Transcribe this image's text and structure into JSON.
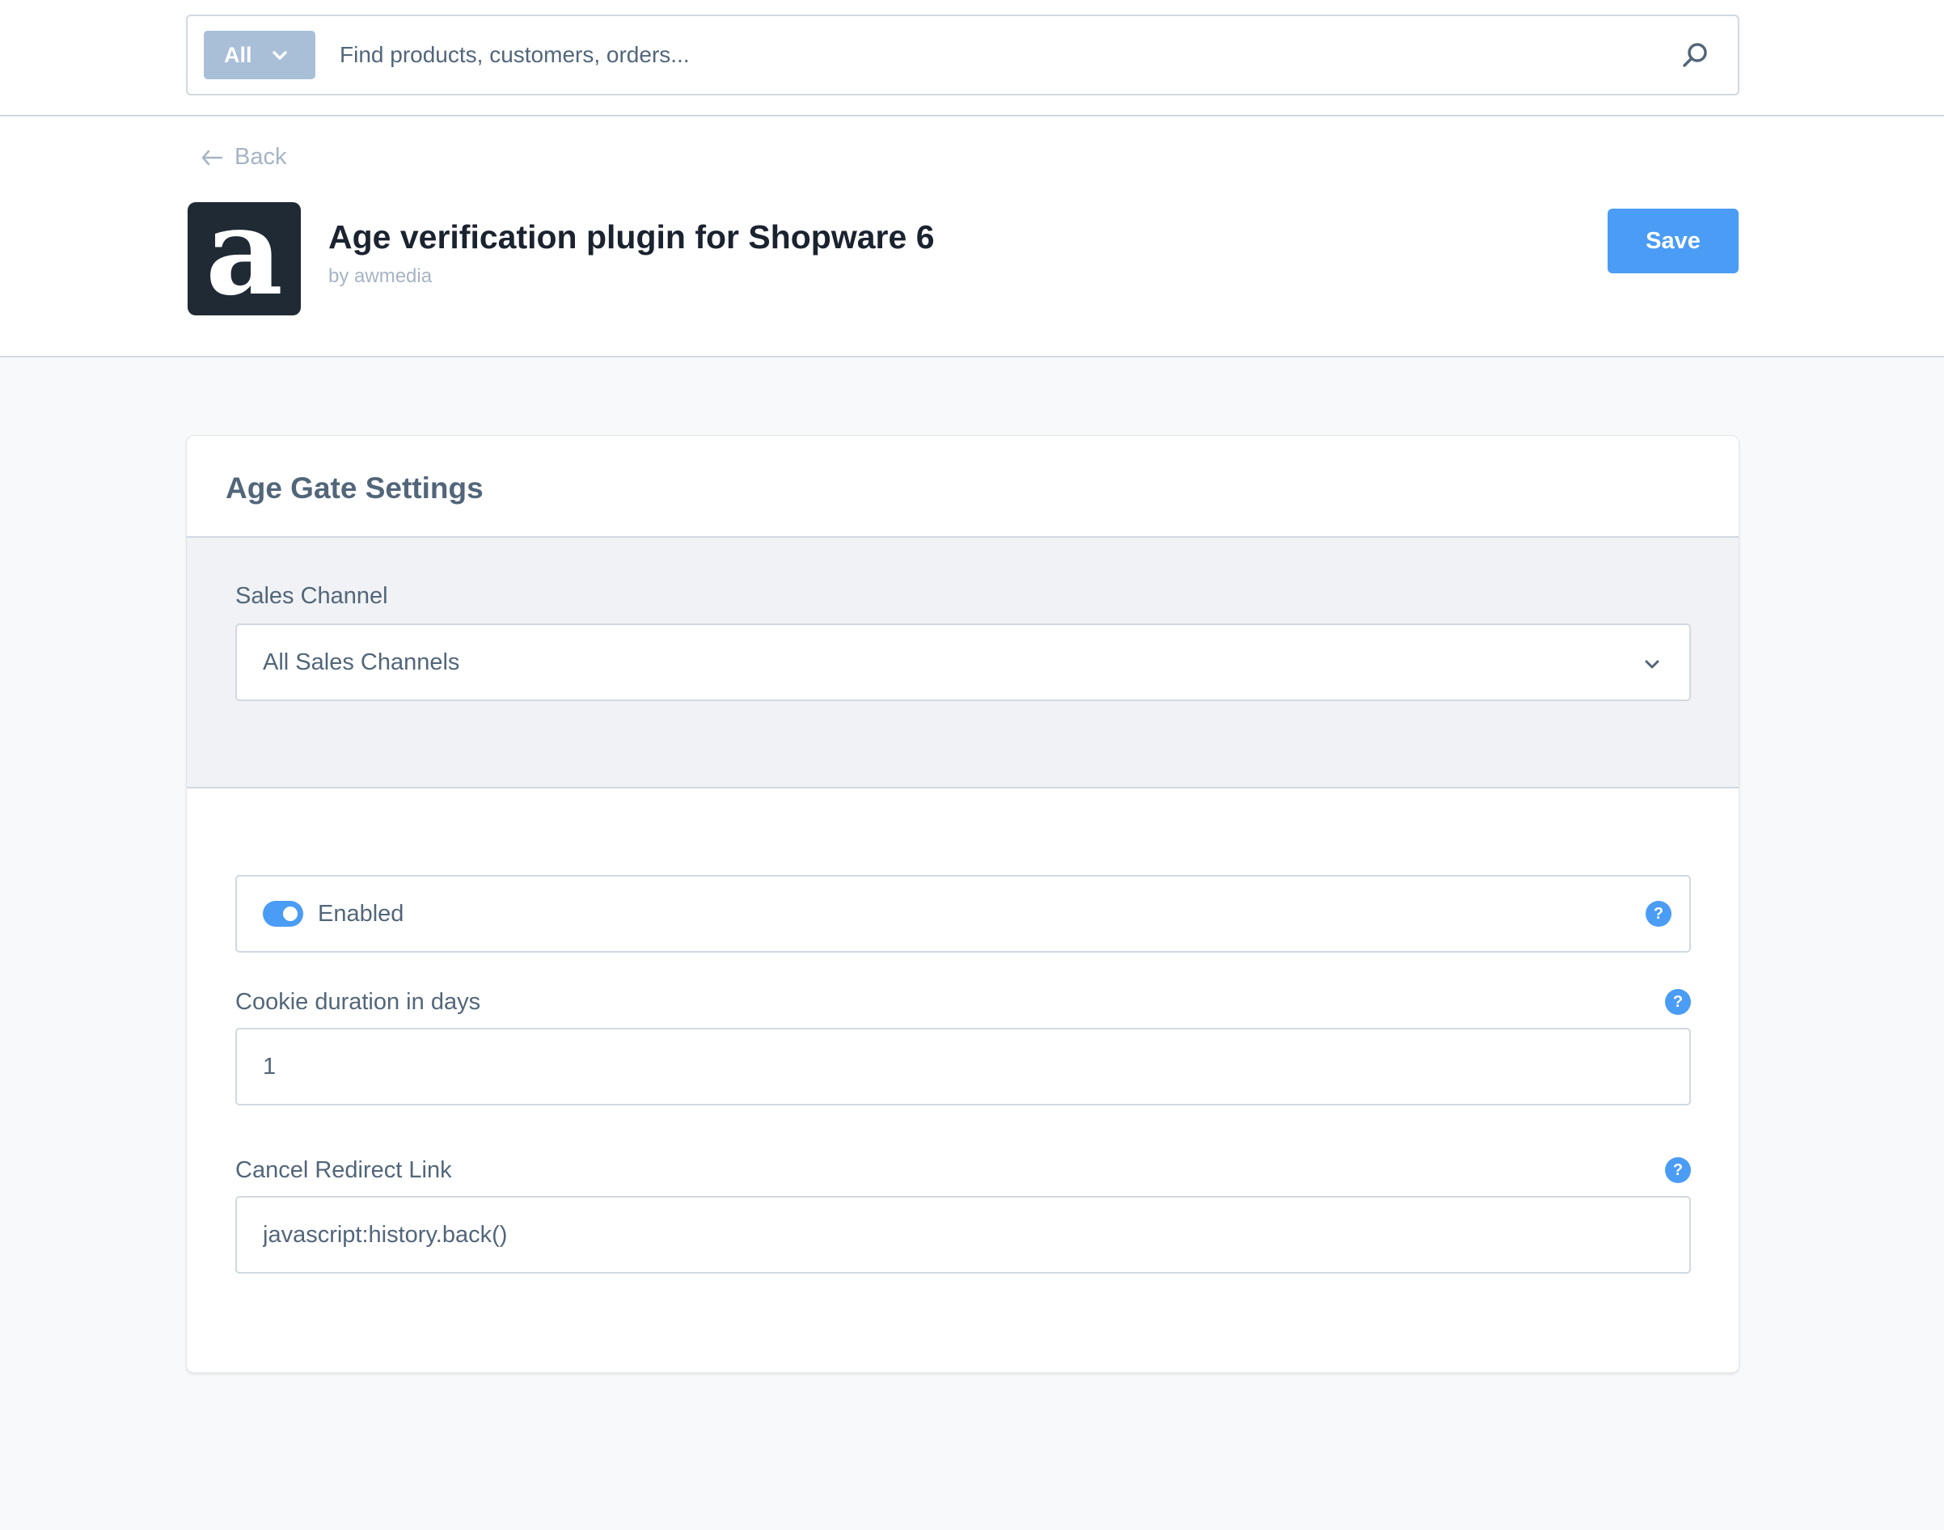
{
  "search": {
    "type_label": "All",
    "placeholder": "Find products, customers, orders..."
  },
  "header": {
    "back_label": "Back",
    "logo_letter": "a",
    "title": "Age verification plugin for Shopware 6",
    "byline": "by awmedia",
    "save_label": "Save"
  },
  "card": {
    "title": "Age Gate Settings",
    "sales_channel": {
      "label": "Sales Channel",
      "selected": "All Sales Channels"
    },
    "enabled": {
      "label": "Enabled",
      "value": true
    },
    "cookie_duration": {
      "label": "Cookie duration in days",
      "value": "1"
    },
    "cancel_redirect": {
      "label": "Cancel Redirect Link",
      "value": "javascript:history.back()"
    },
    "help_glyph": "?"
  },
  "colors": {
    "accent": "#4a9cf5",
    "logo_bg": "#1f2a35",
    "type_pill": "#a9bfd8"
  }
}
